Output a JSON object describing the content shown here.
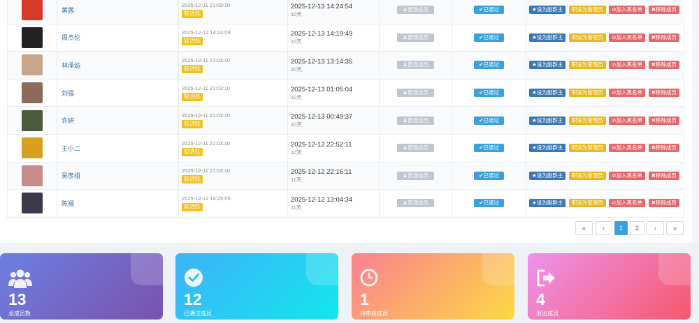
{
  "members": [
    {
      "name": "黄茜",
      "joined": "2025-12-11 21:03:10",
      "status": "较活跃",
      "last_active": "2025-12-13 14:24:54",
      "days": "10天",
      "avatar_color": "#d83a2a"
    },
    {
      "name": "周杰伦",
      "joined": "2025-12-12 14:24:09",
      "status": "较活跃",
      "last_active": "2025-12-13 14:19:49",
      "days": "10天",
      "avatar_color": "#222222"
    },
    {
      "name": "林泽焰",
      "joined": "2025-12-11 21:03:10",
      "status": "较活跃",
      "last_active": "2025-12-13 13:14:35",
      "days": "10天",
      "avatar_color": "#c9a68a"
    },
    {
      "name": "刘强",
      "joined": "2025-12-11 21:03:10",
      "status": "较活跃",
      "last_active": "2025-12-13 01:05:04",
      "days": "10天",
      "avatar_color": "#8a6a5a"
    },
    {
      "name": "许妍",
      "joined": "2025-12-11 21:03:10",
      "status": "较活跃",
      "last_active": "2025-12-13 00:49:37",
      "days": "10天",
      "avatar_color": "#4a5a3a"
    },
    {
      "name": "王小二",
      "joined": "2025-12-11 21:03:10",
      "status": "较活跃",
      "last_active": "2025-12-12 22:52:11",
      "days": "10天",
      "avatar_color": "#d9a020"
    },
    {
      "name": "吴彦祖",
      "joined": "2025-12-11 21:03:10",
      "status": "较活跃",
      "last_active": "2025-12-12 22:16:11",
      "days": "11天",
      "avatar_color": "#c98a8a"
    },
    {
      "name": "陈福",
      "joined": "2025-12-12 14:25:05",
      "status": "较活跃",
      "last_active": "2025-12-12 13:04:34",
      "days": "11天",
      "avatar_color": "#3a3a4a"
    }
  ],
  "row_buttons": {
    "normal_member": "普通成员",
    "approved": "已通过",
    "set_deputy": "设为副群主",
    "set_admin": "职设为管理员",
    "blacklist": "加入黑名单",
    "remove": "移除成员"
  },
  "pagination": {
    "first": "«",
    "prev": "‹",
    "pages": [
      "1",
      "2"
    ],
    "current": "1",
    "next": "›",
    "last": "»"
  },
  "stats": [
    {
      "value": "13",
      "label": "总成员数",
      "icon": "users-icon"
    },
    {
      "value": "12",
      "label": "已通过成员",
      "icon": "check-circle-icon"
    },
    {
      "value": "1",
      "label": "待审核成员",
      "icon": "clock-icon"
    },
    {
      "value": "4",
      "label": "退出成员",
      "icon": "sign-out-icon"
    }
  ]
}
